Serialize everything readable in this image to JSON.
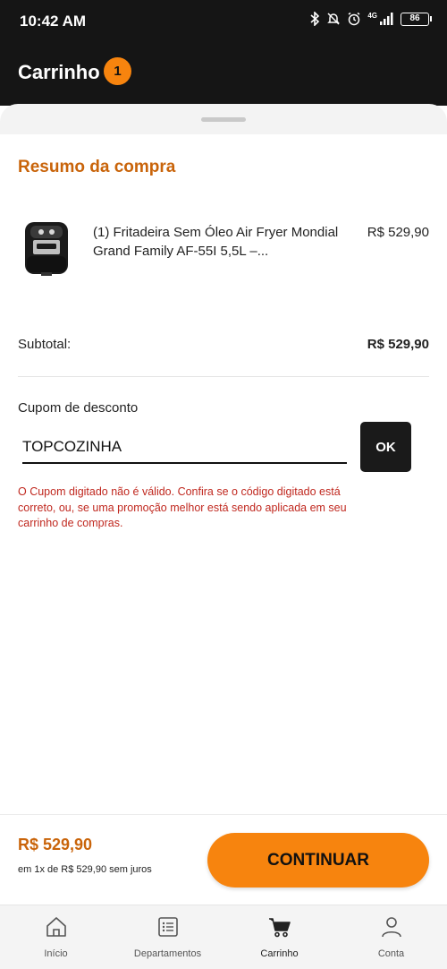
{
  "status_bar": {
    "time": "10:42 AM",
    "network": "4G",
    "battery": "86",
    "icons": [
      "bluetooth-icon",
      "silent-icon",
      "alarm-icon",
      "signal-icon",
      "battery-icon"
    ]
  },
  "header": {
    "title": "Carrinho",
    "badge_count": "1",
    "accent_color": "#f7840e"
  },
  "summary": {
    "title": "Resumo da compra",
    "title_color": "#c9640a"
  },
  "product": {
    "name": "(1) Fritadeira Sem Óleo Air Fryer Mondial Grand Family AF-55I 5,5L –...",
    "price": "R$ 529,90",
    "image_icon": "air-fryer-image"
  },
  "subtotal": {
    "label": "Subtotal:",
    "value": "R$ 529,90"
  },
  "coupon": {
    "label": "Cupom de desconto",
    "value": "TOPCOZINHA",
    "button_label": "OK",
    "error_message": "O Cupom digitado não é válido. Confira se o código digitado está correto, ou, se uma promoção melhor está sendo aplicada em seu carrinho de compras.",
    "error_color": "#c0281f"
  },
  "footer": {
    "total": "R$ 529,90",
    "installments": "em 1x de R$ 529,90 sem juros",
    "continue_label": "CONTINUAR"
  },
  "bottom_nav": {
    "items": [
      {
        "label": "Início",
        "icon": "home-icon"
      },
      {
        "label": "Departamentos",
        "icon": "list-icon"
      },
      {
        "label": "Carrinho",
        "icon": "cart-icon",
        "active": true
      },
      {
        "label": "Conta",
        "icon": "user-icon"
      }
    ]
  }
}
